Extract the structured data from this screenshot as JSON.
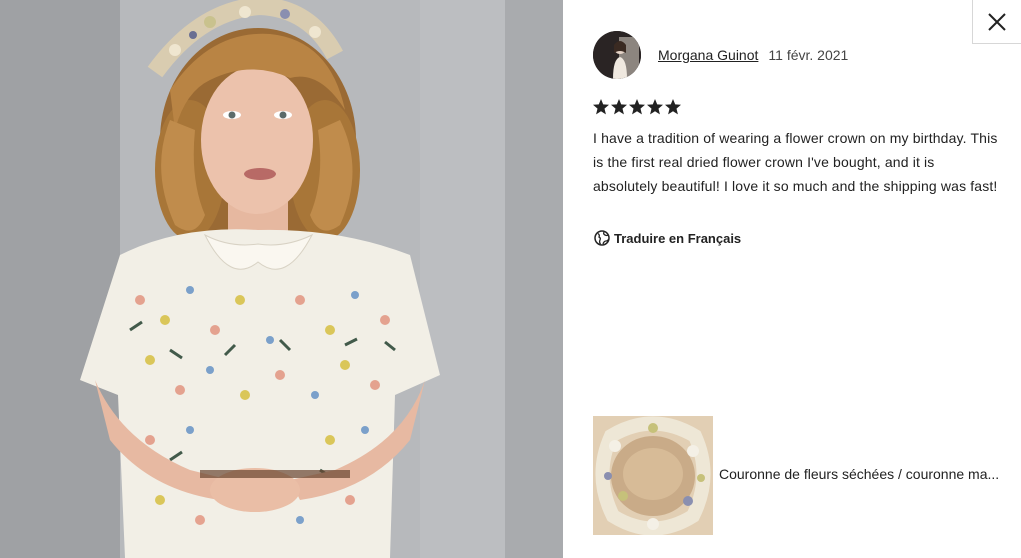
{
  "review": {
    "reviewer_name": "Morgana Guinot",
    "date": "11 févr. 2021",
    "rating": 5,
    "max_rating": 5,
    "text": "I have a tradition of wearing a flower crown on my birthday. This is the first real dried flower crown I've bought, and it is absolutely beautiful! I love it so much and the shipping was fast!",
    "translate_label": "Traduire en Français"
  },
  "product": {
    "title": "Couronne de fleurs séchées / couronne ma..."
  },
  "colors": {
    "star": "#222222",
    "text": "#222222",
    "border": "#d7d7d7"
  },
  "icons": {
    "close": "close-icon",
    "star": "star-icon",
    "translate": "globe-icon"
  }
}
